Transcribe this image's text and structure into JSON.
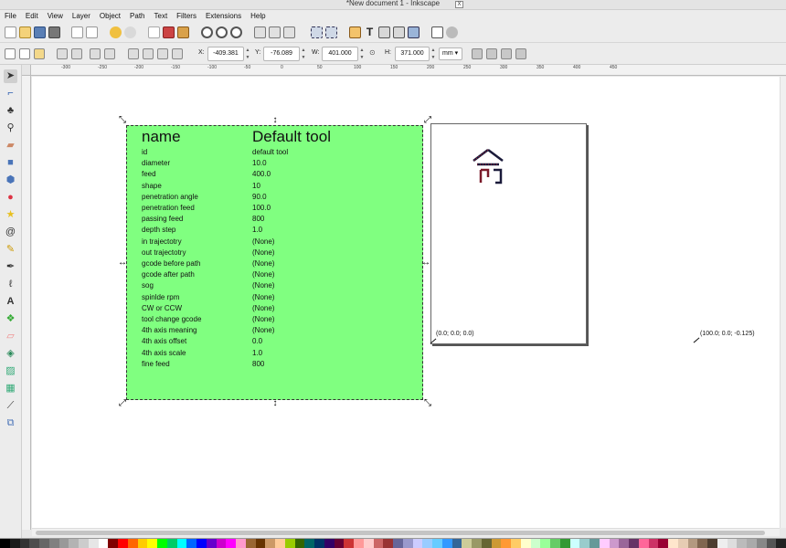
{
  "window": {
    "title": "*New document 1 - Inkscape"
  },
  "menus": [
    "File",
    "Edit",
    "View",
    "Layer",
    "Object",
    "Path",
    "Text",
    "Filters",
    "Extensions",
    "Help"
  ],
  "toolbar": {
    "x_label": "X:",
    "x_value": "-409.381",
    "y_label": "Y:",
    "y_value": "-76.089",
    "w_label": "W:",
    "w_value": "401.000",
    "h_label": "H:",
    "h_value": "371.000",
    "unit": "mm"
  },
  "ruler_ticks": [
    "-300",
    "-250",
    "-200",
    "-150",
    "-100",
    "-50",
    "0",
    "50",
    "100",
    "150",
    "200",
    "250",
    "300",
    "350",
    "400",
    "450"
  ],
  "tool_table": {
    "head_name": "name",
    "head_value": "Default tool",
    "rows": [
      {
        "key": "id",
        "val": "default tool"
      },
      {
        "key": "diameter",
        "val": "10.0"
      },
      {
        "key": "feed",
        "val": "400.0"
      },
      {
        "key": "shape",
        "val": "10"
      },
      {
        "key": "penetration angle",
        "val": "90.0"
      },
      {
        "key": "penetration feed",
        "val": "100.0"
      },
      {
        "key": "passing feed",
        "val": "800"
      },
      {
        "key": "depth step",
        "val": "1.0"
      },
      {
        "key": "in trajectotry",
        "val": "(None)"
      },
      {
        "key": "out trajectotry",
        "val": "(None)"
      },
      {
        "key": "gcode before path",
        "val": "(None)"
      },
      {
        "key": "gcode after path",
        "val": "(None)"
      },
      {
        "key": "sog",
        "val": "(None)"
      },
      {
        "key": "spinlde rpm",
        "val": "(None)"
      },
      {
        "key": "CW or CCW",
        "val": "(None)"
      },
      {
        "key": "tool change gcode",
        "val": "(None)"
      },
      {
        "key": "4th axis meaning",
        "val": "(None)"
      },
      {
        "key": "4th axis offset",
        "val": "0.0"
      },
      {
        "key": "4th axis scale",
        "val": "1.0"
      },
      {
        "key": "fine feed",
        "val": "800"
      }
    ]
  },
  "orientation_points": {
    "origin_label": "(0.0; 0.0; 0.0)",
    "second_label": "(100.0; 0.0; -0.125)"
  },
  "palette": [
    "#000000",
    "#1a1a1a",
    "#333333",
    "#4d4d4d",
    "#666666",
    "#808080",
    "#999999",
    "#b3b3b3",
    "#cccccc",
    "#e6e6e6",
    "#ffffff",
    "#800000",
    "#ff0000",
    "#ff6600",
    "#ffcc00",
    "#ffff00",
    "#00ff00",
    "#00cc66",
    "#00ffff",
    "#0066ff",
    "#0000ff",
    "#6600cc",
    "#cc00cc",
    "#ff00ff",
    "#ff99cc",
    "#996633",
    "#663300",
    "#cc9966",
    "#ffcc99",
    "#99cc00",
    "#336600",
    "#006666",
    "#003366",
    "#330066",
    "#660033",
    "#cc3333",
    "#ff9999",
    "#ffcccc",
    "#cc6666",
    "#993333",
    "#666699",
    "#9999cc",
    "#ccccff",
    "#99ccff",
    "#66ccff",
    "#3399ff",
    "#336699",
    "#cccc99",
    "#999966",
    "#666633",
    "#cc9933",
    "#ff9933",
    "#ffcc66",
    "#ffffcc",
    "#ccffcc",
    "#99ff99",
    "#66cc66",
    "#339933",
    "#ccffff",
    "#99cccc",
    "#669999",
    "#ffccff",
    "#cc99cc",
    "#996699",
    "#663366",
    "#ff6699",
    "#cc3366",
    "#990033",
    "#ffe6cc",
    "#e6ccb3",
    "#b39980",
    "#806650",
    "#4d3d30",
    "#eeeeee",
    "#dddddd",
    "#bbbbbb",
    "#aaaaaa",
    "#888888",
    "#555555",
    "#222222"
  ]
}
